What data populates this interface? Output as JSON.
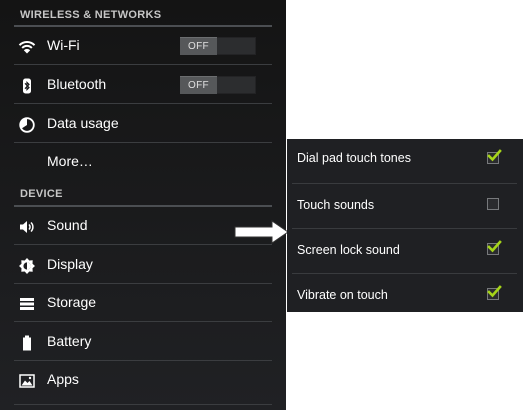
{
  "settings": {
    "wireless_header": "WIRELESS & NETWORKS",
    "wifi": {
      "label": "Wi-Fi",
      "icon": "wifi-icon",
      "toggle": "OFF"
    },
    "bluetooth": {
      "label": "Bluetooth",
      "icon": "bluetooth-icon",
      "toggle": "OFF"
    },
    "data_usage": {
      "label": "Data usage",
      "icon": "data-usage-icon"
    },
    "more": {
      "label": "More…"
    },
    "device_header": "DEVICE",
    "sound": {
      "label": "Sound",
      "icon": "speaker-icon"
    },
    "display": {
      "label": "Display",
      "icon": "brightness-icon"
    },
    "storage": {
      "label": "Storage",
      "icon": "storage-icon"
    },
    "battery": {
      "label": "Battery",
      "icon": "battery-icon"
    },
    "apps": {
      "label": "Apps",
      "icon": "apps-icon"
    }
  },
  "sound_settings": {
    "items": [
      {
        "label": "Dial pad touch tones",
        "checked": true
      },
      {
        "label": "Touch sounds",
        "checked": false
      },
      {
        "label": "Screen lock sound",
        "checked": true
      },
      {
        "label": "Vibrate on touch",
        "checked": true
      }
    ]
  },
  "colors": {
    "panel_bg": "#1f2023",
    "check_green": "#a5d419",
    "text": "#ffffff",
    "header_text": "#c6c6c6"
  }
}
